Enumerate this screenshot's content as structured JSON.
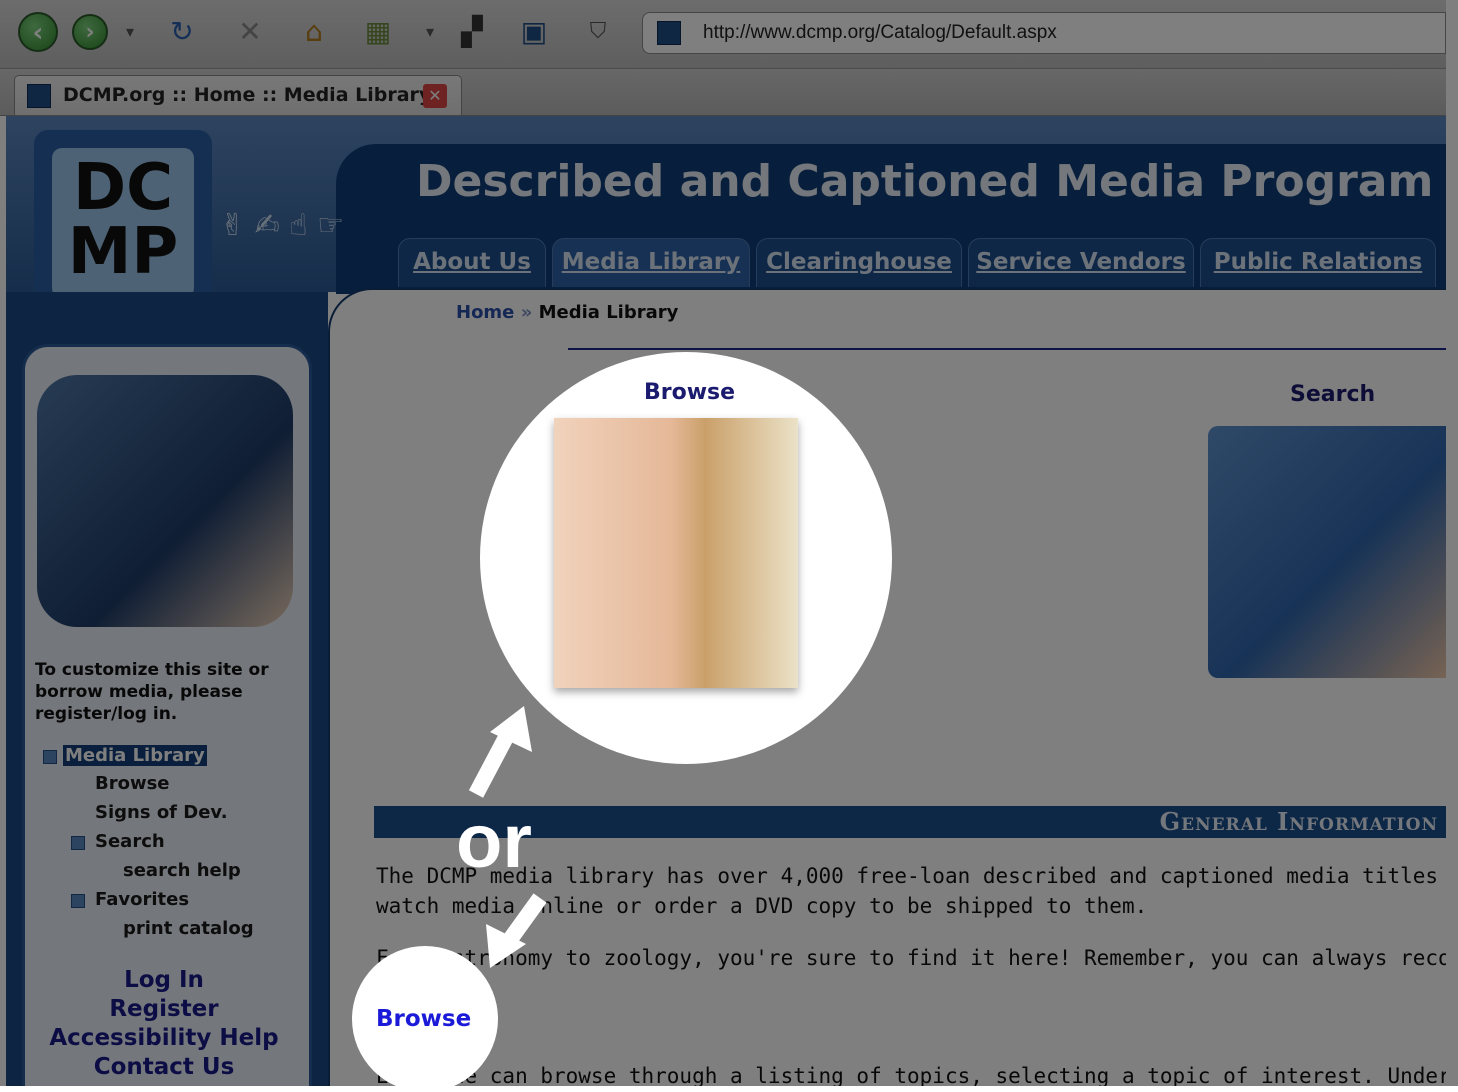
{
  "browser": {
    "url": "http://www.dcmp.org/Catalog/Default.aspx",
    "tab_title": "DCMP.org :: Home :: Media Library"
  },
  "site": {
    "title": "Described and Captioned Media Program",
    "logo_text": "DCMP",
    "nav": [
      "About Us",
      "Media Library",
      "Clearinghouse",
      "Service Vendors",
      "Public Relations"
    ],
    "active_nav": "Media Library"
  },
  "breadcrumb": {
    "home": "Home",
    "separator": "»",
    "current": "Media Library"
  },
  "sidebar": {
    "intro": "To customize this site or borrow media, please register/log in.",
    "tree": {
      "root": "Media Library",
      "items": [
        "Browse",
        "Signs of Dev.",
        "Search",
        "search help",
        "Favorites",
        "print catalog"
      ]
    },
    "links": [
      "Log In",
      "Register",
      "Accessibility Help",
      "Contact Us"
    ]
  },
  "main": {
    "browse_heading": "Browse",
    "search_heading": "Search",
    "section_title": "General Information",
    "para1_line1": "The DCMP media library has over 4,000 free-loan described and captioned media titles av",
    "para1_line2": "watch media online or order a DVD copy to be shipped to them.",
    "para2": "From astronomy to zoology, you're sure to find it here! Remember, you can always recom",
    "browse_link": "Browse",
    "para3": "Everyone can browse through a listing of topics, selecting a topic of interest. Under each"
  },
  "overlay": {
    "or_text": "or"
  },
  "colors": {
    "banner": "#0f3e78",
    "nav_link": "#1a1ad8",
    "overlay": "rgba(0,0,0,0.5)"
  }
}
